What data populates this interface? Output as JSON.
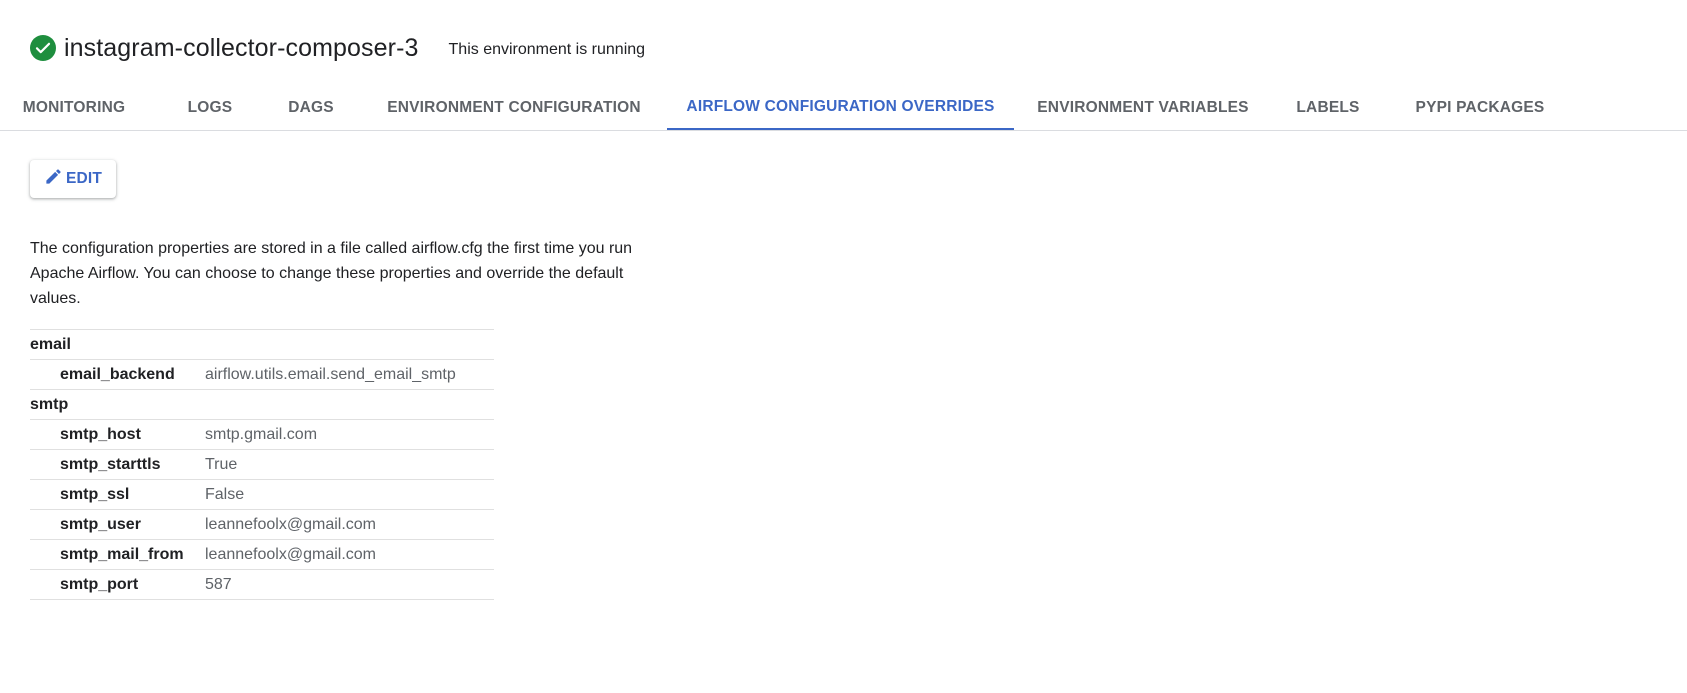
{
  "header": {
    "title": "instagram-collector-composer-3",
    "status_text": "This environment is running",
    "status_icon": "check-circle-icon",
    "status_color": "#1e8e3e"
  },
  "tabs": [
    {
      "label": "MONITORING",
      "active": false
    },
    {
      "label": "LOGS",
      "active": false
    },
    {
      "label": "DAGS",
      "active": false
    },
    {
      "label": "ENVIRONMENT CONFIGURATION",
      "active": false
    },
    {
      "label": "AIRFLOW CONFIGURATION OVERRIDES",
      "active": true
    },
    {
      "label": "ENVIRONMENT VARIABLES",
      "active": false
    },
    {
      "label": "LABELS",
      "active": false
    },
    {
      "label": "PYPI PACKAGES",
      "active": false
    }
  ],
  "toolbar": {
    "edit_label": "EDIT",
    "edit_icon": "pencil-icon"
  },
  "description": "The configuration properties are stored in a file called airflow.cfg the first time you run Apache Airflow. You can choose to change these properties and override the default values.",
  "config": {
    "sections": [
      {
        "name": "email",
        "entries": [
          {
            "key": "email_backend",
            "value": "airflow.utils.email.send_email_smtp"
          }
        ]
      },
      {
        "name": "smtp",
        "entries": [
          {
            "key": "smtp_host",
            "value": "smtp.gmail.com"
          },
          {
            "key": "smtp_starttls",
            "value": "True"
          },
          {
            "key": "smtp_ssl",
            "value": "False"
          },
          {
            "key": "smtp_user",
            "value": "leannefoolx@gmail.com"
          },
          {
            "key": "smtp_mail_from",
            "value": "leannefoolx@gmail.com"
          },
          {
            "key": "smtp_port",
            "value": "587"
          }
        ]
      }
    ]
  },
  "colors": {
    "accent": "#3b67c6",
    "tab_inactive": "#5f6368",
    "divider": "#dadce0"
  }
}
